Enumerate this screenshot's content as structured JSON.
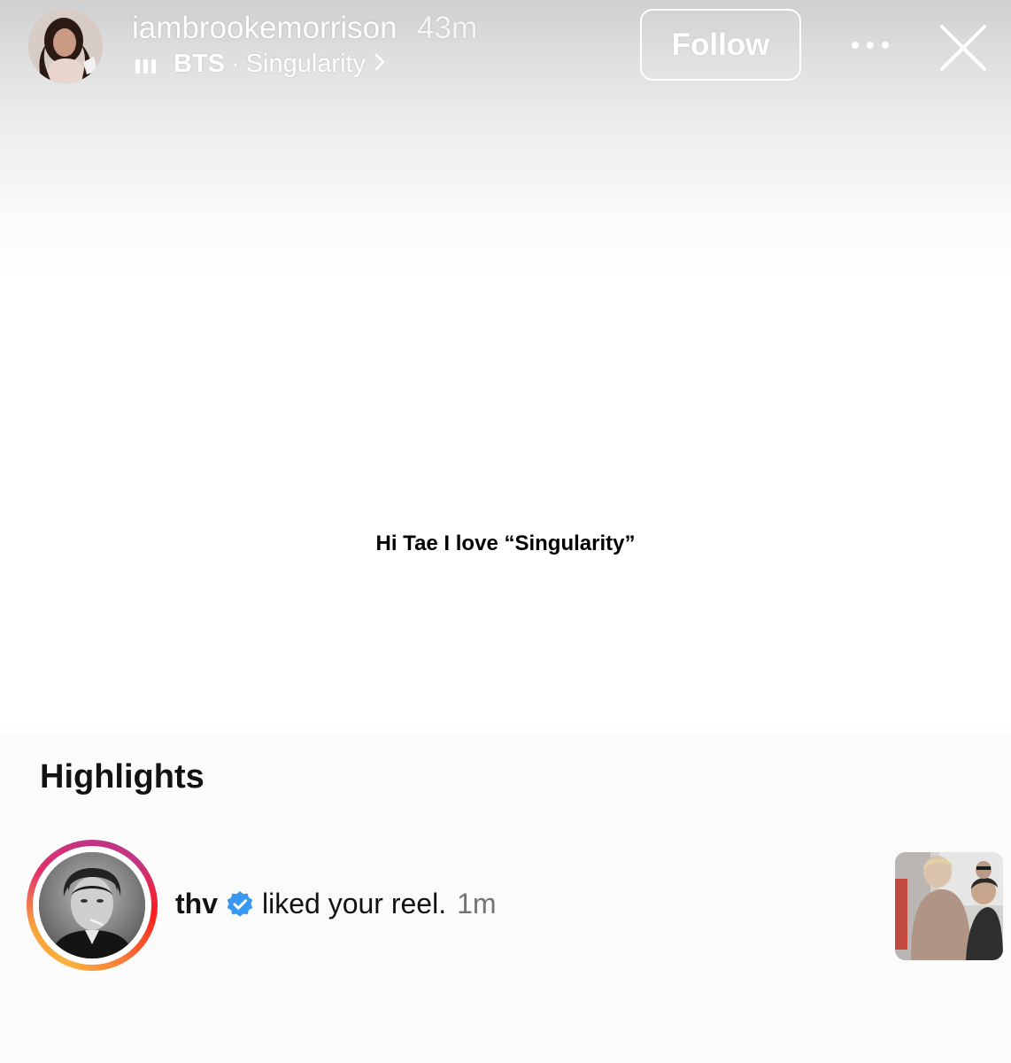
{
  "header": {
    "username": "iambrookemorrison",
    "time_ago": "43m",
    "music": {
      "artist": "BTS",
      "separator": "·",
      "song": "Singularity",
      "chevron": "›"
    },
    "follow_label": "Follow",
    "more_icon": "ellipsis-icon",
    "close_icon": "close-icon"
  },
  "story": {
    "text": "Hi Tae I love “Singularity”"
  },
  "highlights": {
    "title": "Highlights",
    "notification": {
      "username": "thv",
      "verified_icon": "verified-badge-icon",
      "action": "liked your reel.",
      "time": "1m"
    }
  },
  "colors": {
    "verified_blue": "#3897f0",
    "secondary_text": "#737373",
    "story_ring": [
      "#fbb040",
      "#f77737",
      "#e1306c",
      "#c13584"
    ]
  }
}
